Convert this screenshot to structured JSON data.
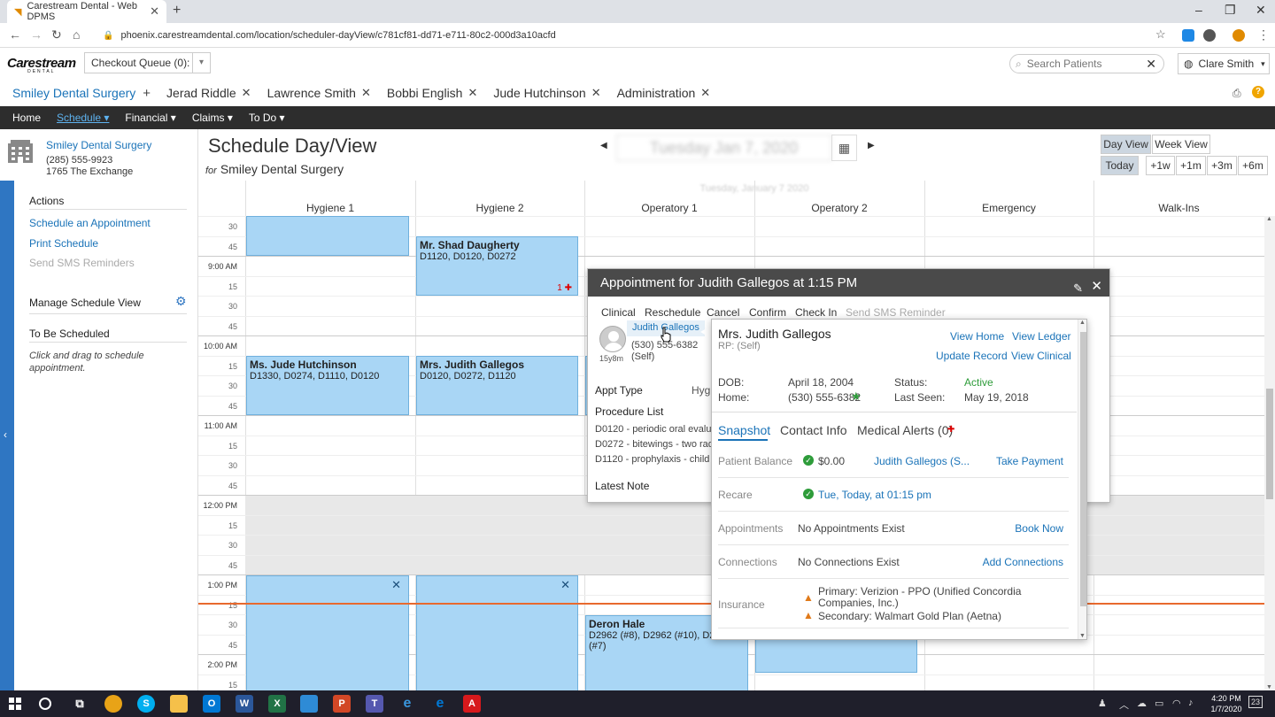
{
  "browser": {
    "tab_title": "Carestream Dental - Web DPMS",
    "url": "phoenix.carestreamdental.com/location/scheduler-dayView/c781cf81-dd71-e711-80c2-000d3a10acfd",
    "window_controls": [
      "–",
      "❐",
      "✕"
    ]
  },
  "app": {
    "logo_text": "Carestream",
    "logo_sub": "DENTAL",
    "checkout_queue": "Checkout Queue (0):",
    "search_placeholder": "Search Patients",
    "user_name": "Clare Smith"
  },
  "patient_tabs": [
    {
      "label": "Smiley Dental Surgery"
    },
    {
      "label": "Jerad Riddle"
    },
    {
      "label": "Lawrence Smith"
    },
    {
      "label": "Bobbi English"
    },
    {
      "label": "Jude Hutchinson"
    },
    {
      "label": "Administration"
    }
  ],
  "main_nav": [
    "Home",
    "Schedule ▾",
    "Financial ▾",
    "Claims ▾",
    "To Do ▾"
  ],
  "sidebar": {
    "location_name": "Smiley Dental Surgery",
    "location_phone": "(285) 555-9923",
    "location_address": "1765 The Exchange",
    "actions_heading": "Actions",
    "action_links": [
      "Schedule an Appointment",
      "Print Schedule"
    ],
    "action_disabled": "Send SMS Reminders",
    "manage_view": "Manage Schedule View",
    "to_be_scheduled": "To Be Scheduled",
    "to_be_scheduled_help": "Click and drag to schedule appointment."
  },
  "schedule": {
    "title": "Schedule Day/View",
    "for_prefix": "for",
    "for_location": "Smiley Dental Surgery",
    "date": "Tuesday Jan 7, 2020",
    "grid_date": "Tuesday, January 7 2020",
    "view_buttons": [
      "Day View",
      "Week View"
    ],
    "jump_buttons": [
      "Today",
      "+1w",
      "+1m",
      "+3m",
      "+6m"
    ],
    "columns": [
      "Hygiene 1",
      "Hygiene 2",
      "Operatory 1",
      "Operatory 2",
      "Emergency",
      "Walk-Ins"
    ],
    "time_labels": [
      "30",
      "45",
      "9:00 AM",
      "15",
      "30",
      "45",
      "10:00 AM",
      "15",
      "30",
      "45",
      "11:00 AM",
      "15",
      "30",
      "45",
      "12:00 PM",
      "15",
      "30",
      "45",
      "1:00 PM",
      "15",
      "30",
      "45",
      "2:00 PM",
      "15"
    ],
    "appointments": [
      {
        "name": "",
        "codes": ""
      },
      {
        "name": "Mr. Shad Daugherty",
        "codes": "D1120, D0120, D0272",
        "flag": "1 ✚"
      },
      {
        "name": "Ms. Jude Hutchinson",
        "codes": "D1330, D0274, D1110, D0120"
      },
      {
        "name": "Mrs. Judith Gallegos",
        "codes": "D0120, D0272, D1120"
      },
      {
        "name": "",
        "codes": ""
      },
      {
        "name": "",
        "codes": ""
      },
      {
        "name": "Deron Hale",
        "codes": "D2962 (#8), D2962 (#10), D2962 (#7)"
      }
    ]
  },
  "modal": {
    "title": "Appointment for Judith Gallegos at 1:15 PM",
    "actions": [
      "Clinical",
      "Reschedule",
      "Cancel",
      "Confirm",
      "Check In"
    ],
    "action_disabled": "Send SMS Reminder",
    "patient_name": "Judith Gallegos",
    "patient_phone": "(530) 555-6382",
    "patient_rel": "(Self)",
    "patient_age": "15y8m",
    "appt_type_label": "Appt Type",
    "appt_type_value": "Hygie",
    "procedure_heading": "Procedure List",
    "procedures": [
      "D0120 - periodic oral evalu",
      "D0272 - bitewings - two rad",
      "D1120 - prophylaxis - child"
    ],
    "latest_note": "Latest Note"
  },
  "popover": {
    "name": "Mrs. Judith Gallegos",
    "rp": "RP: (Self)",
    "links": [
      "View Home",
      "View Ledger",
      "Update Record",
      "View Clinical"
    ],
    "dob_label": "DOB:",
    "dob": "April 18, 2004",
    "home_label": "Home:",
    "home": "(530) 555-6382",
    "status_label": "Status:",
    "status": "Active",
    "last_seen_label": "Last Seen:",
    "last_seen": "May 19, 2018",
    "tabs": [
      "Snapshot",
      "Contact Info",
      "Medical Alerts (0)"
    ],
    "rows": [
      {
        "label": "Patient Balance",
        "value": "$0.00",
        "link": "Judith Gallegos (S...",
        "action": "Take Payment"
      },
      {
        "label": "Recare",
        "value": "Tue, Today, at 01:15 pm"
      },
      {
        "label": "Appointments",
        "value": "No Appointments Exist",
        "action": "Book Now"
      },
      {
        "label": "Connections",
        "value": "No Connections Exist",
        "action": "Add Connections"
      }
    ],
    "insurance_label": "Insurance",
    "insurance_primary": "Primary: Verizion - PPO (Unified Concordia Companies, Inc.)",
    "insurance_secondary": "Secondary: Walmart Gold Plan (Aetna)"
  },
  "taskbar": {
    "time": "4:20 PM",
    "date": "1/7/2020",
    "notif_count": "23"
  },
  "colors": {
    "accent": "#1a73b8",
    "nav_bg": "#2d2d2d",
    "appt_fill": "#a9d6f5",
    "now_line": "#e8692e",
    "active_green": "#2e9c3a"
  }
}
